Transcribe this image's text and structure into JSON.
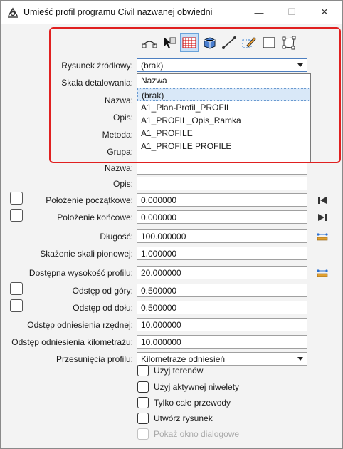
{
  "window": {
    "title": "Umieść profil programu Civil nazwanej obwiedni"
  },
  "toolbar": {
    "icons": [
      "profile-curve-icon",
      "select-arrow-icon",
      "grid-table-icon",
      "3d-box-icon",
      "line-icon",
      "pencil-icon",
      "rectangle-icon",
      "fence-icon"
    ]
  },
  "form": {
    "source_drawing": {
      "label": "Rysunek źródłowy:",
      "value": "(brak)"
    },
    "detail_scale": {
      "label": "Skala detalowania:"
    },
    "name": {
      "label": "Nazwa:"
    },
    "description": {
      "label": "Opis:"
    },
    "method": {
      "label": "Metoda:"
    },
    "group": {
      "label": "Grupa:"
    },
    "name2": {
      "label": "Nazwa:"
    },
    "description2": {
      "label": "Opis:",
      "value": ""
    },
    "start_position": {
      "label": "Położenie początkowe:",
      "value": "0.000000"
    },
    "end_position": {
      "label": "Położenie końcowe:",
      "value": "0.000000"
    },
    "length": {
      "label": "Długość:",
      "value": "100.000000"
    },
    "vertical_exaggeration": {
      "label": "Skażenie skali pionowej:",
      "value": "1.000000"
    },
    "available_height": {
      "label": "Dostępna wysokość profilu:",
      "value": "20.000000"
    },
    "top_offset": {
      "label": "Odstęp od góry:",
      "value": "0.500000"
    },
    "bottom_offset": {
      "label": "Odstęp od dołu:",
      "value": "0.500000"
    },
    "elevation_ref_offset": {
      "label": "Odstęp odniesienia rzędnej:",
      "value": "10.000000"
    },
    "station_ref_offset": {
      "label": "Odstęp odniesienia kilometrażu:",
      "value": "10.000000"
    },
    "profile_shifts": {
      "label": "Przesunięcia profilu:",
      "value": "Kilometraże odniesień"
    }
  },
  "dropdown": {
    "header": "Nazwa",
    "items": [
      "(brak)",
      "A1_Plan-Profil_PROFIL",
      "A1_PROFIL_Opis_Ramka",
      "A1_PROFILE",
      "A1_PROFILE PROFILE"
    ]
  },
  "checkboxes": {
    "use_terrains": "Użyj terenów",
    "use_active_level": "Użyj aktywnej niwelety",
    "whole_conduits": "Tylko całe przewody",
    "create_drawing": "Utwórz rysunek",
    "show_dialog": "Pokaż okno dialogowe"
  }
}
